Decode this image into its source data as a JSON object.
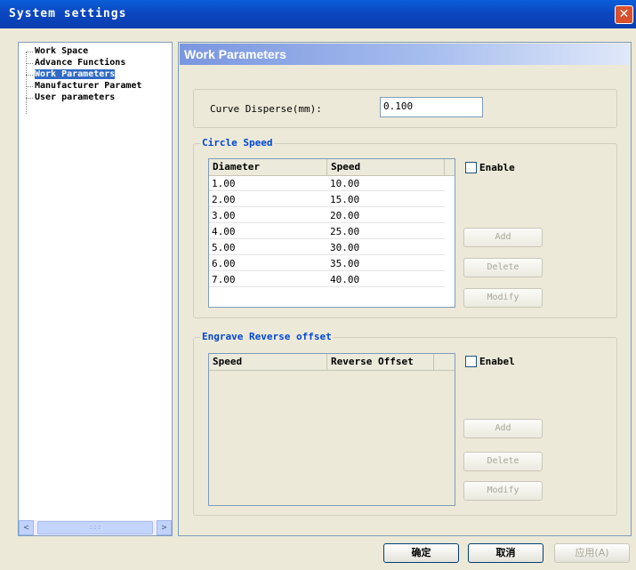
{
  "window": {
    "title": "System settings"
  },
  "tree": {
    "items": [
      {
        "label": "Work Space"
      },
      {
        "label": "Advance Functions"
      },
      {
        "label": "Work Parameters"
      },
      {
        "label": "Manufacturer Paramet"
      },
      {
        "label": "User parameters"
      }
    ],
    "selected_index": 2
  },
  "panel": {
    "title": "Work Parameters",
    "curve_disperse": {
      "label": "Curve Disperse(mm):",
      "value": "0.100"
    },
    "circle_speed": {
      "legend": "Circle Speed",
      "columns": [
        "Diameter",
        "Speed"
      ],
      "rows": [
        [
          "1.00",
          "10.00"
        ],
        [
          "2.00",
          "15.00"
        ],
        [
          "3.00",
          "20.00"
        ],
        [
          "4.00",
          "25.00"
        ],
        [
          "5.00",
          "30.00"
        ],
        [
          "6.00",
          "35.00"
        ],
        [
          "7.00",
          "40.00"
        ]
      ],
      "enable_label": "Enable",
      "add_label": "Add",
      "delete_label": "Delete",
      "modify_label": "Modify"
    },
    "reverse_offset": {
      "legend": "Engrave Reverse offset",
      "columns": [
        "Speed",
        "Reverse Offset"
      ],
      "enable_label": "Enabel",
      "add_label": "Add",
      "delete_label": "Delete",
      "modify_label": "Modify"
    }
  },
  "footer": {
    "ok_label": "确定",
    "cancel_label": "取消",
    "apply_label": "应用(A)"
  },
  "colors": {
    "titlebar": "#0b47c1",
    "selection": "#316ac5",
    "legend": "#0046d5"
  }
}
